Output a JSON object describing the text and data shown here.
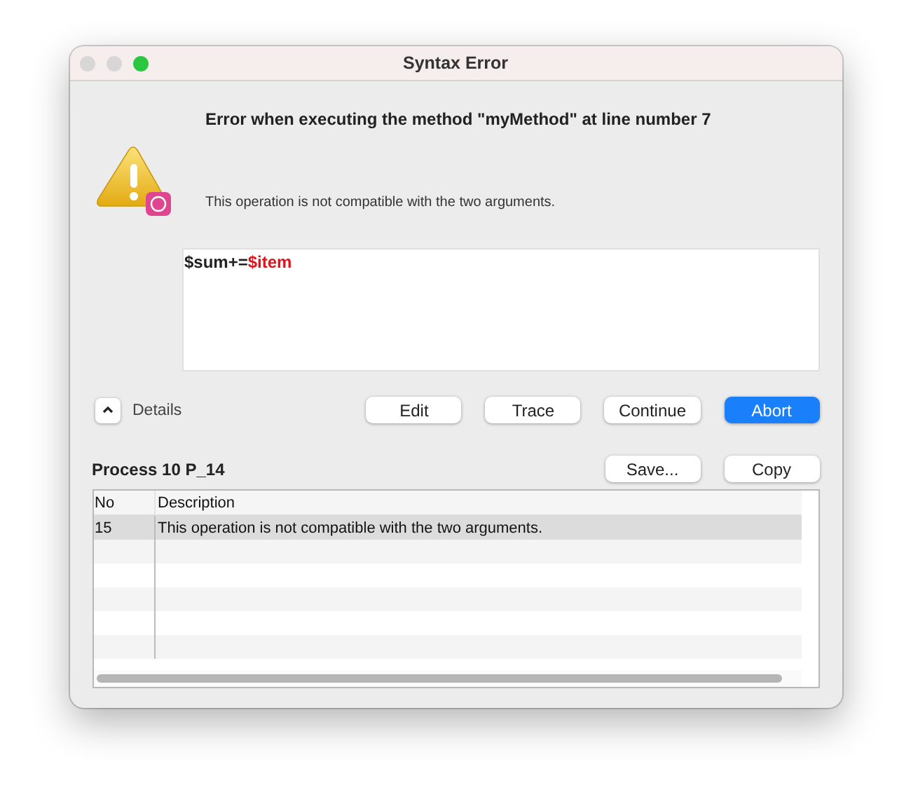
{
  "window": {
    "title": "Syntax Error",
    "controls": [
      {
        "kind": "close"
      },
      {
        "kind": "minimize"
      },
      {
        "kind": "zoom"
      }
    ]
  },
  "heading": "Error when executing the method \"myMethod\" at line number 7",
  "message": "This operation is not compatible with the two arguments.",
  "code": [
    {
      "text": "$sum+=",
      "kind": "plain"
    },
    {
      "text": "$item",
      "kind": "error"
    }
  ],
  "details": {
    "label": "Details",
    "expanded": true
  },
  "buttons": [
    {
      "label": "Edit",
      "default": false
    },
    {
      "label": "Trace",
      "default": false
    },
    {
      "label": "Continue",
      "default": false
    },
    {
      "label": "Abort",
      "default": true
    }
  ],
  "process": "Process 10 P_14",
  "process_buttons": [
    "Save...",
    "Copy"
  ],
  "table": {
    "columns": [
      "No",
      "Description"
    ],
    "rows": [
      {
        "cells": [
          "15",
          "This operation is not compatible with the two arguments."
        ],
        "selected": true
      }
    ]
  }
}
